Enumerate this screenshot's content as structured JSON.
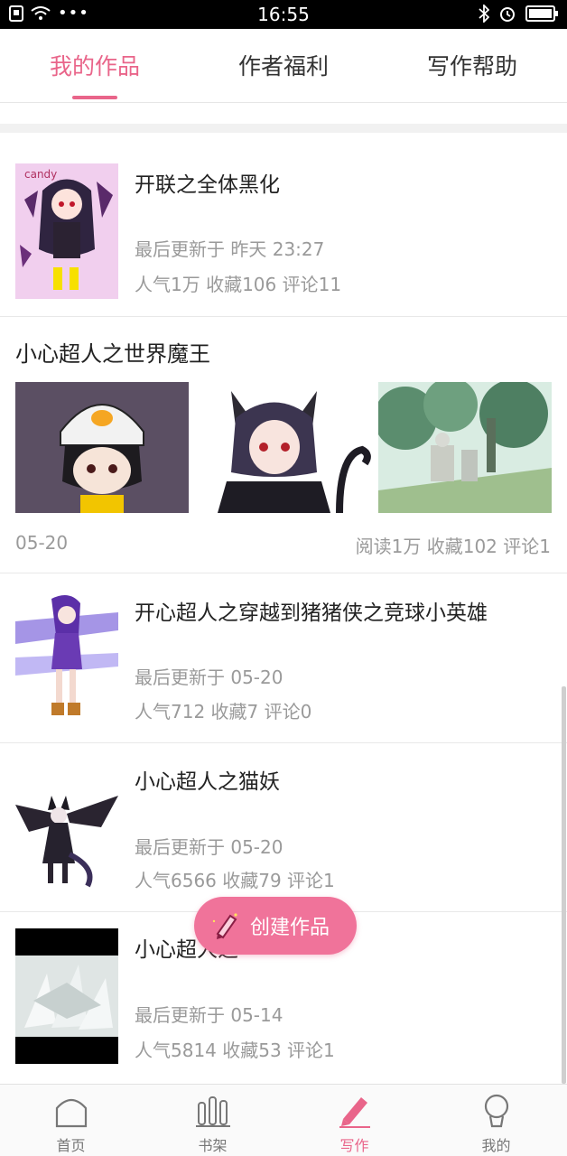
{
  "status_bar": {
    "time": "16:55"
  },
  "tabs": [
    {
      "label": "我的作品",
      "active": true
    },
    {
      "label": "作者福利",
      "active": false
    },
    {
      "label": "写作帮助",
      "active": false
    }
  ],
  "works": [
    {
      "title": "开联之全体黑化",
      "updated": "最后更新于 昨天 23:27",
      "stats": "人气1万  收藏106  评论11",
      "thumb_text": "candy"
    },
    {
      "title": "开心超人之穿越到猪猪侠之竞球小英雄",
      "updated": "最后更新于 05-20",
      "stats": "人气712  收藏7  评论0"
    },
    {
      "title": "小心超人之猫妖",
      "updated": "最后更新于 05-20",
      "stats": "人气6566  收藏79  评论1"
    },
    {
      "title": "小心超人之",
      "updated": "最后更新于 05-14",
      "stats": "人气5814  收藏53  评论1"
    }
  ],
  "gallery_work": {
    "title": "小心超人之世界魔王",
    "date": "05-20",
    "stats": "阅读1万  收藏102  评论1"
  },
  "fab": {
    "label": "创建作品"
  },
  "bottom_nav": [
    {
      "label": "首页",
      "icon": "home-icon"
    },
    {
      "label": "书架",
      "icon": "bookshelf-icon"
    },
    {
      "label": "写作",
      "icon": "pencil-icon",
      "active": true
    },
    {
      "label": "我的",
      "icon": "profile-icon"
    }
  ],
  "colors": {
    "accent": "#e9658a",
    "fab": "#f0739a",
    "meta_text": "#9a9a9a"
  }
}
